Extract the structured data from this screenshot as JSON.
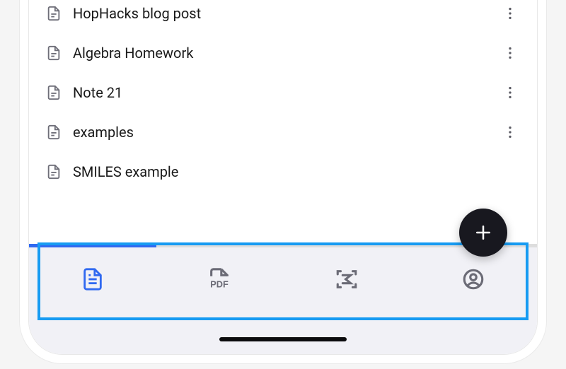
{
  "notes": [
    {
      "title": "HopHacks blog post"
    },
    {
      "title": "Algebra Homework"
    },
    {
      "title": "Note 21"
    },
    {
      "title": "examples"
    },
    {
      "title": "SMILES example"
    }
  ],
  "fab": {
    "label": "New note"
  },
  "nav": {
    "items": [
      {
        "name": "documents",
        "active": true
      },
      {
        "name": "pdf",
        "active": false
      },
      {
        "name": "scan-math",
        "active": false
      },
      {
        "name": "profile",
        "active": false
      }
    ]
  },
  "colors": {
    "accent": "#3069f0",
    "highlight": "#179bf2",
    "fab_bg": "#18181f"
  }
}
